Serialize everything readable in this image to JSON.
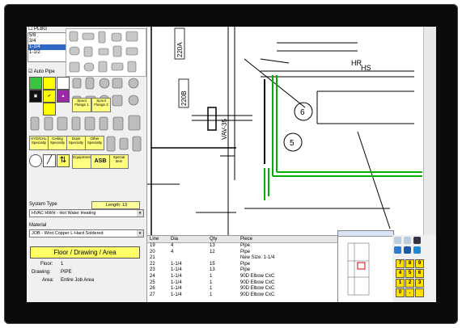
{
  "left_panel": {
    "plbg_label": "PLBG",
    "sizes": [
      "5/8",
      "3/4",
      "1-1/4",
      "1-1/2"
    ],
    "sizes_selected": "1-1/4",
    "auto_pipe_label": "Auto Pipe",
    "btn_spool_flange1": "Spool Flange 1",
    "btn_spool_flange2": "Spool Flange 2",
    "btn_hyd_specialty": "HYD/CHL Specialty",
    "btn_ceiling_specialty": "Ceiling Specialty",
    "btn_drain_specialty": "Drain Specialty",
    "btn_other_specialty": "Other Specialty",
    "btn_equipment": "Equipment",
    "btn_asb": "ASB",
    "btn_special_item": "Special Item",
    "length_label": "Length: 13",
    "system_type_label": "System Type",
    "system_type_value": "HVAC HWH -  Hot Water Heating",
    "material_label": "Material",
    "material_value": "JOB - Wrot Copper L-Hard Soldered",
    "floor_drawing_area_btn": "Floor / Drawing / Area",
    "floor_label": "Floor:",
    "floor_value": "1",
    "drawing_label": "Drawing:",
    "drawing_value": "PIPE",
    "area_label": "Area:",
    "area_value": "Entire Job Area"
  },
  "drawing": {
    "labels": [
      "220A",
      "220B",
      "VAV-35",
      "HR",
      "HS",
      "6",
      "5"
    ]
  },
  "table": {
    "headers": [
      "Line",
      "Dia",
      "Qty",
      "Piece"
    ],
    "rows": [
      [
        "19",
        "4",
        "13",
        "Pipe"
      ],
      [
        "20",
        "4",
        "12",
        "Pipe"
      ],
      [
        "21",
        "",
        "",
        "New Size: 1-1/4"
      ],
      [
        "22",
        "1-1/4",
        "15",
        "Pipe"
      ],
      [
        "23",
        "1-1/4",
        "13",
        "Pipe"
      ],
      [
        "24",
        "1-1/4",
        "1",
        "90D Elbow CxC"
      ],
      [
        "25",
        "1-1/4",
        "1",
        "90D Elbow CxC"
      ],
      [
        "26",
        "1-1/4",
        "1",
        "90D Elbow CxC"
      ],
      [
        "27",
        "1-1/4",
        "1",
        "90D Elbow CxC"
      ]
    ]
  },
  "keypad": [
    "7",
    "8",
    "9",
    "4",
    "5",
    "6",
    "1",
    "2",
    "3",
    "0",
    "."
  ],
  "colors": {
    "pipe_green": "#00b000",
    "key_yellow": "#ffe000",
    "bezel": "#0b0b0b"
  }
}
